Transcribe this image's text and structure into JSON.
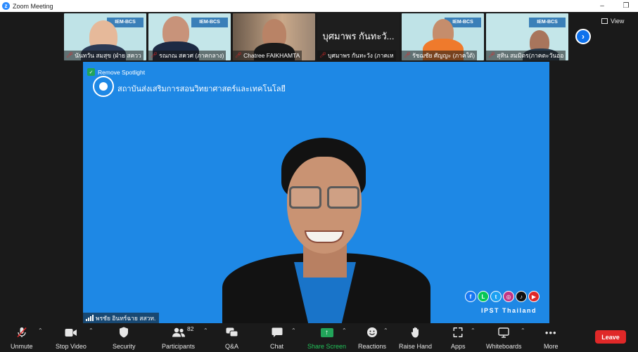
{
  "window": {
    "title": "Zoom Meeting",
    "minimize_glyph": "–",
    "restore_glyph": "❐"
  },
  "strip": {
    "participants": [
      {
        "name": "นันทวัน สมสุข (ฝ่าย สควว",
        "muted": true,
        "banner": "IEM-BCS"
      },
      {
        "name": "รณกณ สควศ (ภาคกลาง)",
        "muted": true,
        "banner": "IEM-BCS"
      },
      {
        "name": "Chatree FAIKHAMTA",
        "muted": true
      },
      {
        "name": "บุศมาพร กันทะวัง (ภาคเห",
        "muted": true,
        "big_name": "บุศมาพร กันทะวั..."
      },
      {
        "name": "รัชฌชัย ศัญญะ (ภาคใต้)",
        "muted": true,
        "banner": "IEM-BCS"
      },
      {
        "name": "สุทิน สมมิตร(ภาคตะวันออ",
        "muted": true,
        "banner": "IEM-BCS"
      }
    ],
    "next_glyph": "›",
    "view_label": "View"
  },
  "main": {
    "remove_spotlight_label": "Remove Spotlight",
    "org_name": "สถาบันส่งเสริมการสอนวิทยาศาสตร์และเทคโนโลยี",
    "social_icons": [
      "facebook-icon",
      "line-icon",
      "twitter-icon",
      "instagram-icon",
      "tiktok-icon",
      "youtube-icon"
    ],
    "social_glyphs": [
      "f",
      "L",
      "t",
      "◎",
      "♪",
      "▶"
    ],
    "brand_text": "IPST Thailand",
    "speaker_name": "พรชัย อินทร์ฉาย สสวท."
  },
  "toolbar": {
    "unmute": "Unmute",
    "stop_video": "Stop Video",
    "security": "Security",
    "participants": "Participants",
    "participants_count": "82",
    "qa": "Q&A",
    "chat": "Chat",
    "share_screen": "Share Screen",
    "reactions": "Reactions",
    "raise_hand": "Raise Hand",
    "apps": "Apps",
    "whiteboards": "Whiteboards",
    "more": "More",
    "leave": "Leave"
  },
  "colors": {
    "zoom_blue": "#0e72ed",
    "spotlight_bg": "#1e88e5",
    "share_green": "#22a45a",
    "leave_red": "#e02828",
    "mute_red": "#e02828"
  }
}
